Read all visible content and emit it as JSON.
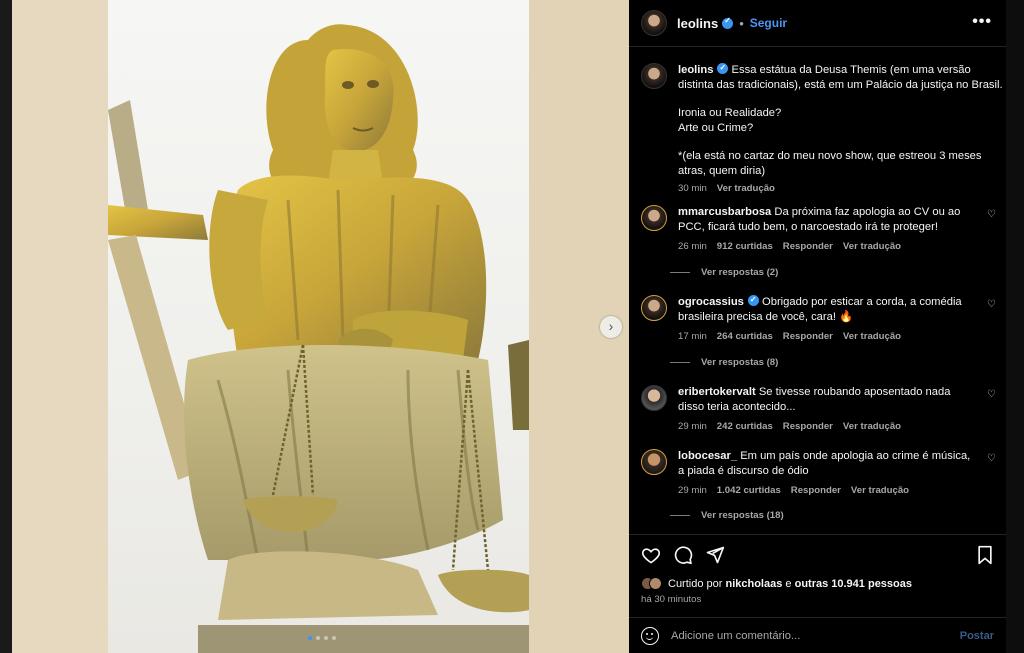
{
  "post": {
    "author": "leolins",
    "follow_label": "Seguir",
    "more_label": "•••"
  },
  "caption": {
    "author": "leolins",
    "text_line1": "Essa estátua da Deusa Themis (em uma versão distinta das tradicionais), está em um Palácio da justiça no Brasil.",
    "text_line2": "Ironia ou Realidade?",
    "text_line3": "Arte ou Crime?",
    "text_line4": "*(ela está no cartaz do meu novo show, que estreou 3 meses atras, quem diria)",
    "time": "30 min",
    "translate": "Ver tradução"
  },
  "comments": [
    {
      "user": "mmarcusbarbosa",
      "text": "Da próxima faz apologia ao CV ou ao PCC, ficará tudo bem, o narcoestado irá te proteger!",
      "time": "26 min",
      "likes": "912 curtidas",
      "reply": "Responder",
      "translate": "Ver tradução",
      "view_replies": "Ver respostas (2)"
    },
    {
      "user": "ogrocassius",
      "text": "Obrigado por esticar a corda, a comédia brasileira precisa de você, cara! 🔥",
      "time": "17 min",
      "likes": "264 curtidas",
      "reply": "Responder",
      "translate": "Ver tradução",
      "view_replies": "Ver respostas (8)"
    },
    {
      "user": "eribertokervalt",
      "text": "Se tivesse roubando aposentado nada disso teria acontecido...",
      "time": "29 min",
      "likes": "242 curtidas",
      "reply": "Responder",
      "translate": "Ver tradução"
    },
    {
      "user": "lobocesar_",
      "text": "Em um país onde apologia ao crime é música, a piada é discurso de ódio",
      "time": "29 min",
      "likes": "1.042 curtidas",
      "reply": "Responder",
      "translate": "Ver tradução",
      "view_replies": "Ver respostas (18)"
    }
  ],
  "footer": {
    "liked_prefix": "Curtido por",
    "liked_user": "nikcholaas",
    "liked_mid": "e",
    "liked_others": "outras 10.941 pessoas",
    "time_ago": "há 30 minutos",
    "comment_placeholder": "Adicione um comentário...",
    "post_label": "Postar"
  },
  "carousel": {
    "next_arrow": "›",
    "slides_total": 4,
    "active_slide": 1
  },
  "colors": {
    "accent": "#3797f0",
    "follow": "#4d96f5",
    "statue_gold": "#c9a83a"
  }
}
